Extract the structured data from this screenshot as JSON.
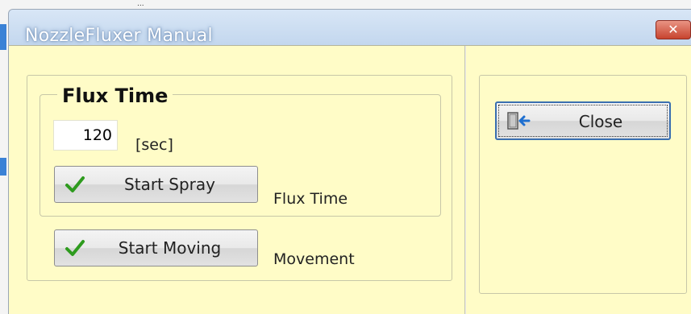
{
  "window": {
    "title": "NozzleFluxer Manual",
    "close_glyph": "✕"
  },
  "background": {
    "partial_text": "..."
  },
  "flux_group": {
    "legend": "Flux Time",
    "time_value": "120",
    "unit": "[sec]"
  },
  "actions": {
    "start_spray_label": "Start Spray",
    "start_spray_caption": "Flux Time",
    "start_moving_label": "Start Moving",
    "start_moving_caption": "Movement"
  },
  "right_panel": {
    "close_label": "Close"
  },
  "icons": {
    "check": "check-icon",
    "exit_door": "exit-door-icon",
    "window_close": "close-icon"
  },
  "colors": {
    "client_bg": "#fffcc7",
    "titlebar": "#c9dcf0",
    "close_red": "#c7432e",
    "check_green": "#2e9b1e"
  }
}
